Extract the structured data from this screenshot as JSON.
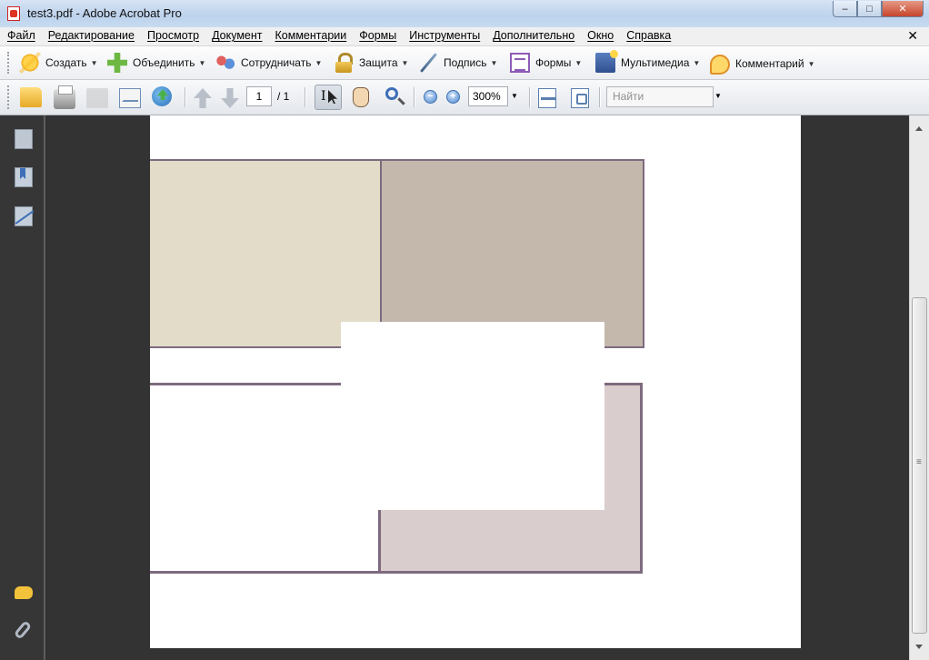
{
  "window": {
    "title": "test3.pdf - Adobe Acrobat Pro",
    "controls": {
      "minimize": "–",
      "maximize": "□",
      "close": "✕"
    }
  },
  "menu": {
    "items": [
      "Файл",
      "Редактирование",
      "Просмотр",
      "Документ",
      "Комментарии",
      "Формы",
      "Инструменты",
      "Дополнительно",
      "Окно",
      "Справка"
    ],
    "close_doc": "✕"
  },
  "toolbar_tasks": [
    {
      "label": "Создать",
      "icon": "create-icon"
    },
    {
      "label": "Объединить",
      "icon": "combine-icon"
    },
    {
      "label": "Сотрудничать",
      "icon": "collaborate-icon"
    },
    {
      "label": "Защита",
      "icon": "lock-icon"
    },
    {
      "label": "Подпись",
      "icon": "pen-icon"
    },
    {
      "label": "Формы",
      "icon": "forms-icon"
    },
    {
      "label": "Мультимедиа",
      "icon": "multimedia-icon"
    },
    {
      "label": "Комментарий",
      "icon": "comment-icon"
    }
  ],
  "toolbar_nav": {
    "current_page": "1",
    "total_pages": "/ 1",
    "zoom": "300%",
    "find_placeholder": "Найти"
  },
  "document": {
    "file": "test3.pdf",
    "colors": {
      "page": "#ffffff",
      "beige": "#e2dcc8",
      "taupe": "#c4b8ad",
      "mauve_light": "#d9cdcd",
      "border": "#7e6a7e",
      "background": "#333333"
    }
  }
}
